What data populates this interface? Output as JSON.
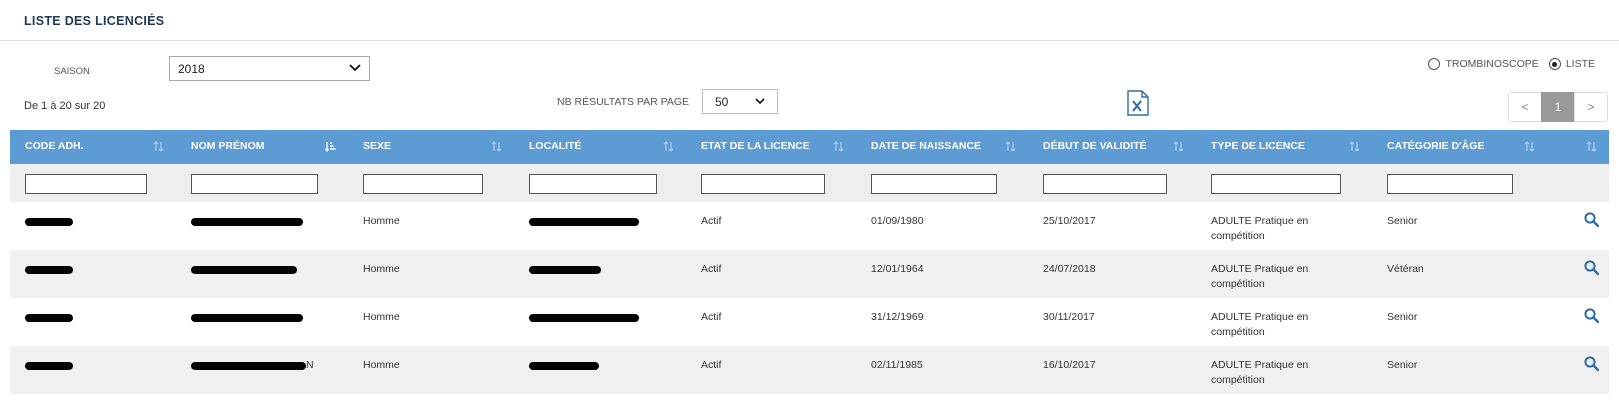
{
  "page": {
    "title": "LISTE DES LICENCIÉS"
  },
  "season": {
    "label": "SAISON",
    "value": "2018"
  },
  "view_toggle": {
    "trombinoscope_label": "TROMBINOSCOPE",
    "liste_label": "LISTE",
    "selected": "liste"
  },
  "results": {
    "count_text": "De 1 à 20 sur 20"
  },
  "per_page": {
    "label": "NB RÉSULTATS PAR PAGE",
    "value": "50"
  },
  "pagination": {
    "prev": "<",
    "current": "1",
    "next": ">"
  },
  "colors": {
    "header_bg": "#5d9bd5",
    "alt_row_bg": "#f0f0f0",
    "excel_icon": "#2f6fa8"
  },
  "icons": {
    "export": "excel-file-icon",
    "sort": "sort-icon",
    "view": "search-icon"
  },
  "columns": [
    {
      "label": "CODE ADH."
    },
    {
      "label": "NOM PRÉNOM"
    },
    {
      "label": "SEXE"
    },
    {
      "label": "LOCALITÉ"
    },
    {
      "label": "ETAT DE LA LICENCE"
    },
    {
      "label": "DATE DE NAISSANCE"
    },
    {
      "label": "DÉBUT DE VALIDITÉ"
    },
    {
      "label": "TYPE DE LICENCE"
    },
    {
      "label": "CATÉGORIE D'ÂGE"
    }
  ],
  "rows": [
    {
      "sexe": "Homme",
      "etat": "Actif",
      "naissance": "01/09/1980",
      "debut": "25/10/2017",
      "type_line1": "ADULTE Pratique en",
      "type_line2": "compétition",
      "categorie": "Senior",
      "nom_suffix": ""
    },
    {
      "sexe": "Homme",
      "etat": "Actif",
      "naissance": "12/01/1964",
      "debut": "24/07/2018",
      "type_line1": "ADULTE Pratique en",
      "type_line2": "compétition",
      "categorie": "Vétéran",
      "nom_suffix": ""
    },
    {
      "sexe": "Homme",
      "etat": "Actif",
      "naissance": "31/12/1969",
      "debut": "30/11/2017",
      "type_line1": "ADULTE Pratique en",
      "type_line2": "compétition",
      "categorie": "Senior",
      "nom_suffix": ""
    },
    {
      "sexe": "Homme",
      "etat": "Actif",
      "naissance": "02/11/1985",
      "debut": "16/10/2017",
      "type_line1": "ADULTE Pratique en",
      "type_line2": "compétition",
      "categorie": "Senior",
      "nom_suffix": "N"
    }
  ]
}
